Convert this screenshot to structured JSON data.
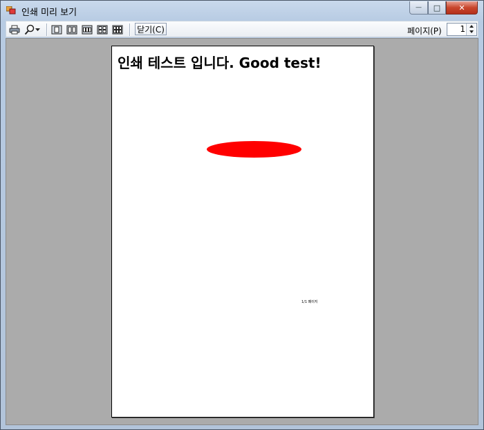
{
  "window": {
    "title": "인쇄 미리 보기",
    "buttons": {
      "minimize": "—",
      "maximize": "□",
      "close": "✕"
    }
  },
  "toolbar": {
    "print_icon": "printer-icon",
    "zoom_icon": "magnifier-icon",
    "layouts": [
      "one-page-icon",
      "two-pages-icon",
      "three-pages-icon",
      "four-pages-icon",
      "six-pages-icon"
    ],
    "close_label": "닫기(C)",
    "page_label": "페이지(P)",
    "page_value": "1"
  },
  "document": {
    "heading": "인쇄 테스트 입니다. Good test!",
    "shape_color": "#ff0000",
    "footer_text": "1/1 페이지"
  }
}
